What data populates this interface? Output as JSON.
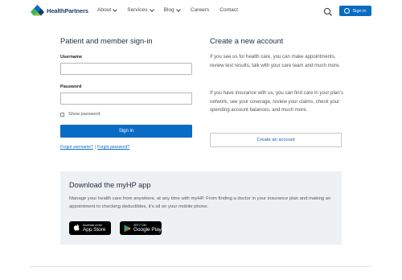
{
  "header": {
    "logo_text": "HealthPartners",
    "nav": [
      {
        "label": "About",
        "has_dropdown": true
      },
      {
        "label": "Services",
        "has_dropdown": true
      },
      {
        "label": "Blog",
        "has_dropdown": true
      },
      {
        "label": "Careers",
        "has_dropdown": false
      },
      {
        "label": "Contact",
        "has_dropdown": false
      }
    ],
    "search_icon": "search-icon",
    "signin_label": "Sign in",
    "signin_icon": "user-icon"
  },
  "signin": {
    "title": "Patient and member sign-in",
    "username_label": "Username",
    "username_value": "",
    "password_label": "Password",
    "password_value": "",
    "show_password_label": "Show password",
    "show_password_checked": false,
    "button_label": "Sign in",
    "forgot_username": "Forgot username?",
    "separator": "|",
    "forgot_password": "Forgot password?"
  },
  "create": {
    "title": "Create a new account",
    "para1": "If you see us for health care, you can make appointments, review test results, talk with your care team and much more.",
    "para2": "If you have insurance with us, you can find care in your plan’s network, see your coverage, review your claims, check your spending account balances, and much more.",
    "button_label": "Create an account"
  },
  "app": {
    "title": "Download the myHP app",
    "description": "Manage your health care from anywhere, at any time with myHP. From finding a doctor in your insurance plan and making an appointment to checking deductibles, it’s all on your mobile phone.",
    "appstore_small": "Download on the",
    "appstore_big": "App Store",
    "googleplay_small": "GET IT ON",
    "googleplay_big": "Google Play"
  },
  "colors": {
    "primary": "#0a6bc4",
    "heading": "#1f2d3d",
    "panel_bg": "#eef1f3"
  }
}
